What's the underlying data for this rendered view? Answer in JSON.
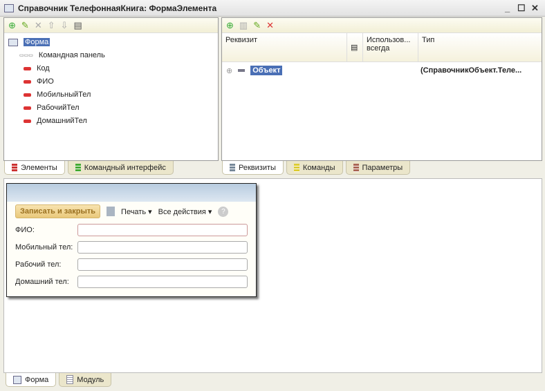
{
  "window": {
    "title": "Справочник ТелефоннаяКнига: ФормаЭлемента"
  },
  "tree": {
    "items": [
      "Форма",
      "Командная панель",
      "Код",
      "ФИО",
      "МобильныйТел",
      "РабочийТел",
      "ДомашнийТел"
    ]
  },
  "left_tabs": [
    "Элементы",
    "Командный интерфейс"
  ],
  "table": {
    "columns": [
      "Реквизит",
      "Использов... всегда",
      "Тип"
    ],
    "row": {
      "name": "Объект",
      "type": "(СправочникОбъект.Теле..."
    }
  },
  "right_tabs": [
    "Реквизиты",
    "Команды",
    "Параметры"
  ],
  "preview": {
    "save_close": "Записать и закрыть",
    "print": "Печать ▾",
    "all_actions": "Все действия ▾",
    "help": "?",
    "fields": [
      "ФИО:",
      "Мобильный тел:",
      "Рабочий тел:",
      "Домашний тел:"
    ]
  },
  "bottom_tabs": [
    "Форма",
    "Модуль"
  ]
}
